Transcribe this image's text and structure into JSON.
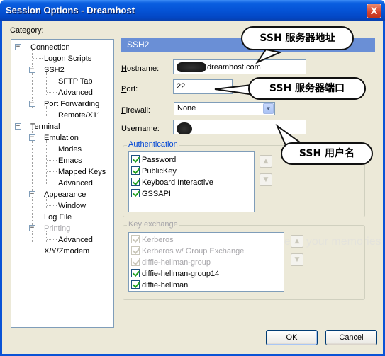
{
  "window": {
    "title": "Session Options - Dreamhost",
    "close_glyph": "X"
  },
  "category_label": "Category:",
  "tree": [
    {
      "label": "Connection",
      "level": 0,
      "expanded": true
    },
    {
      "label": "Logon Scripts",
      "level": 1
    },
    {
      "label": "SSH2",
      "level": 1,
      "expanded": true,
      "selected": true
    },
    {
      "label": "SFTP Tab",
      "level": 2
    },
    {
      "label": "Advanced",
      "level": 2
    },
    {
      "label": "Port Forwarding",
      "level": 1,
      "expanded": true
    },
    {
      "label": "Remote/X11",
      "level": 2
    },
    {
      "label": "Terminal",
      "level": 0,
      "expanded": true
    },
    {
      "label": "Emulation",
      "level": 1,
      "expanded": true
    },
    {
      "label": "Modes",
      "level": 2
    },
    {
      "label": "Emacs",
      "level": 2
    },
    {
      "label": "Mapped Keys",
      "level": 2
    },
    {
      "label": "Advanced",
      "level": 2
    },
    {
      "label": "Appearance",
      "level": 1,
      "expanded": true
    },
    {
      "label": "Window",
      "level": 2
    },
    {
      "label": "Log File",
      "level": 1
    },
    {
      "label": "Printing",
      "level": 1,
      "expanded": true,
      "disabled": true
    },
    {
      "label": "Advanced",
      "level": 2
    },
    {
      "label": "X/Y/Zmodem",
      "level": 1
    }
  ],
  "panel": {
    "title": "SSH2",
    "hostname": {
      "label": "Hostname:",
      "value": "dreamhost.com"
    },
    "port": {
      "label": "Port:",
      "value": "22"
    },
    "firewall": {
      "label": "Firewall:",
      "value": "None"
    },
    "username": {
      "label": "Username:",
      "value": ""
    },
    "authentication": {
      "legend": "Authentication",
      "items": [
        "Password",
        "PublicKey",
        "Keyboard Interactive",
        "GSSAPI"
      ]
    },
    "key_exchange": {
      "legend": "Key exchange",
      "items": [
        "Kerberos",
        "Kerberos w/ Group Exchange",
        "diffie-hellman-group",
        "diffie-hellman-group14",
        "diffie-hellman"
      ]
    }
  },
  "buttons": {
    "ok": "OK",
    "cancel": "Cancel"
  },
  "annotations": {
    "hostname_callout": "SSH 服务器地址",
    "port_callout": "SSH 服务器端口",
    "username_callout": "SSH 用户名"
  },
  "watermark": {
    "top": "Protect more of your memories for less!"
  },
  "colors": {
    "title_bar": "#0553d6",
    "panel_header": "#6a8fd6",
    "dialog_bg": "#ece9d8",
    "field_border": "#7f9db9"
  }
}
